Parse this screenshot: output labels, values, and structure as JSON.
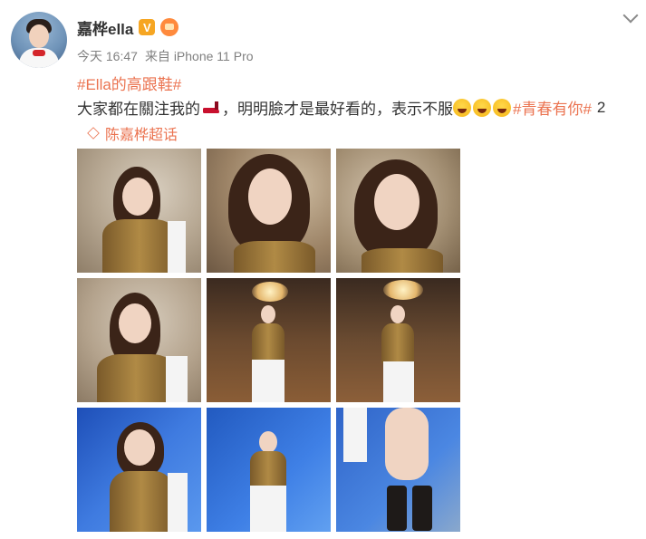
{
  "user": {
    "name": "嘉桦ella",
    "verified_mark": "V",
    "avatar_icon": "avatar-icon",
    "vip_icon": "vip-crown-icon"
  },
  "meta": {
    "time": "今天 16:47",
    "source": "来自 iPhone 11 Pro"
  },
  "post": {
    "topic_title": "#Ella的高跟鞋#",
    "text_part1": "大家都在關注我的",
    "text_part2": "，明明臉才是最好看的，表示不服",
    "topic_inline": "#青春有你#",
    "trailing": "2",
    "supertopic_label": "陈嘉桦超话"
  },
  "photos": {
    "count": 9
  },
  "colors": {
    "topic": "#eb7350",
    "text": "#333333",
    "meta": "#808080",
    "verified": "#f6a623"
  }
}
